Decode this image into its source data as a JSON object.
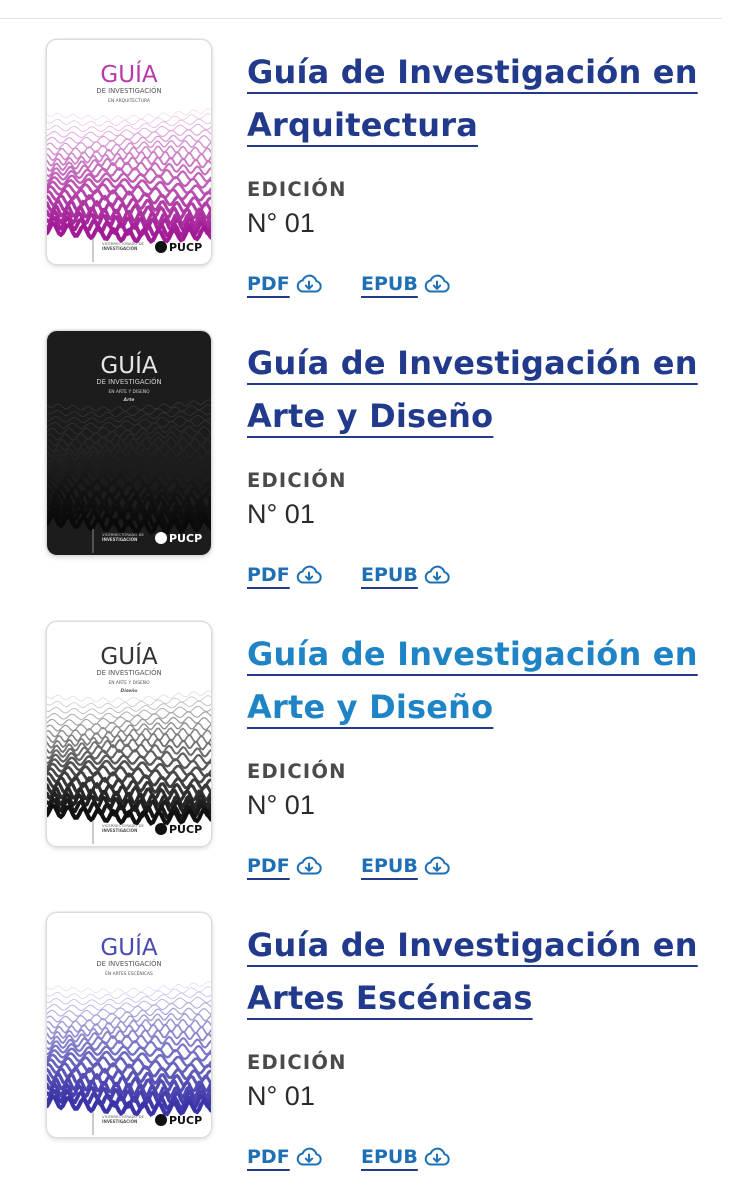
{
  "books": [
    {
      "title_lines": [
        "Guía de Investigación en",
        "Arquitectura"
      ],
      "edition_label": "EDICIÓN",
      "edition_value": "N° 01",
      "pdf_label": "PDF",
      "epub_label": "EPUB",
      "cover": {
        "guia": "GUÍA",
        "de_investigacion": "DE INVESTIGACIÓN",
        "subtitle": "EN ARQUITECTURA",
        "tag": "",
        "vicerrectorado": "VICERRECTORADO DE",
        "investigacion": "INVESTIGACIÓN",
        "brand": "PUCP",
        "bg": "#ffffff",
        "title_color": "#b83aa8",
        "wave_top": "#f3d7ef",
        "wave_bottom": "#a21a96",
        "text_color": "#555555"
      }
    },
    {
      "title_lines": [
        "Guía de Investigación en",
        "Arte y Diseño"
      ],
      "edition_label": "EDICIÓN",
      "edition_value": "N° 01",
      "pdf_label": "PDF",
      "epub_label": "EPUB",
      "cover": {
        "guia": "GUÍA",
        "de_investigacion": "DE INVESTIGACIÓN",
        "subtitle": "EN ARTE Y DISEÑO",
        "tag": "Arte",
        "vicerrectorado": "VICERRECTORADO DE",
        "investigacion": "INVESTIGACIÓN",
        "brand": "PUCP",
        "bg": "#1c1c1c",
        "title_color": "#e6e6e6",
        "wave_top": "#3a3a3a",
        "wave_bottom": "#0a0a0a",
        "text_color": "#cfcfcf"
      }
    },
    {
      "title_lines": [
        "Guía de Investigación en",
        "Arte y Diseño"
      ],
      "edition_label": "EDICIÓN",
      "edition_value": "N° 01",
      "pdf_label": "PDF",
      "epub_label": "EPUB",
      "cover": {
        "guia": "GUÍA",
        "de_investigacion": "DE INVESTIGACIÓN",
        "subtitle": "EN ARTE Y DISEÑO",
        "tag": "Diseño",
        "vicerrectorado": "VICERRECTORADO DE",
        "investigacion": "INVESTIGACIÓN",
        "brand": "PUCP",
        "bg": "#ffffff",
        "title_color": "#333333",
        "wave_top": "#d9d9d9",
        "wave_bottom": "#111111",
        "text_color": "#555555"
      }
    },
    {
      "title_lines": [
        "Guía de Investigación en",
        "Artes Escénicas"
      ],
      "edition_label": "EDICIÓN",
      "edition_value": "N° 01",
      "pdf_label": "PDF",
      "epub_label": "EPUB",
      "cover": {
        "guia": "GUÍA",
        "de_investigacion": "DE INVESTIGACIÓN",
        "subtitle": "EN ARTES ESCÉNICAS",
        "tag": "",
        "vicerrectorado": "VICERRECTORADO DE",
        "investigacion": "INVESTIGACIÓN",
        "brand": "PUCP",
        "bg": "#ffffff",
        "title_color": "#4a4ab0",
        "wave_top": "#dcdcf4",
        "wave_bottom": "#3b34a8",
        "text_color": "#555555"
      }
    }
  ],
  "colors": {
    "title": "#213a8c",
    "title_hover": "#1f84c6",
    "link": "#1f6fb5",
    "label": "#4a4a4a"
  },
  "icons": {
    "download": "cloud-download-icon"
  }
}
